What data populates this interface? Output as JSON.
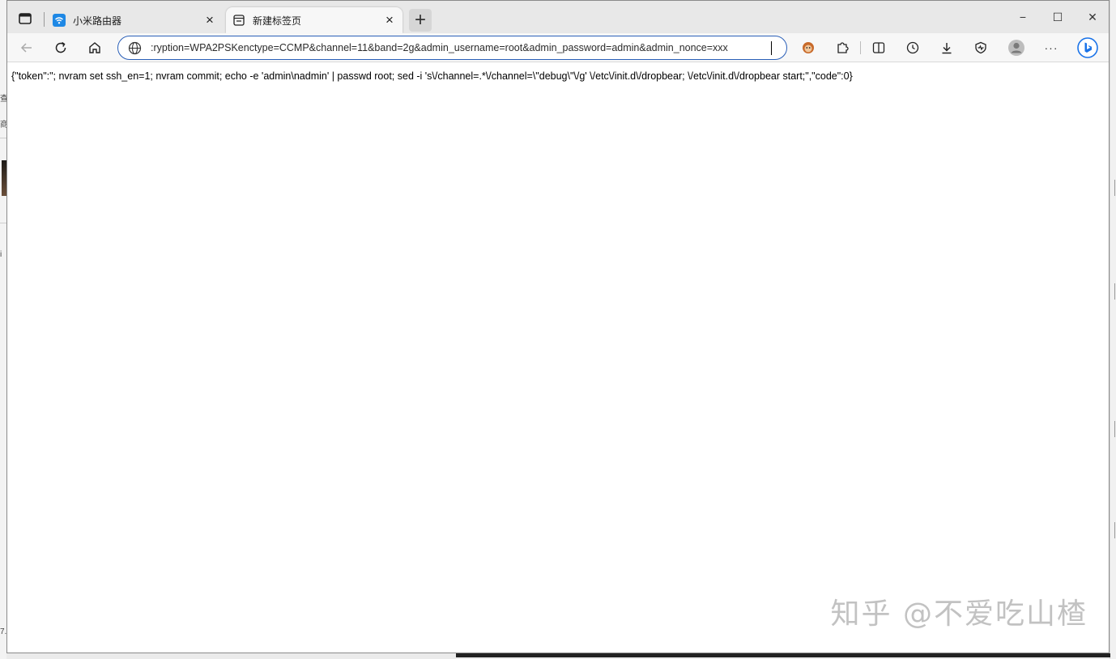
{
  "window": {
    "tabs": [
      {
        "label": "小米路由器",
        "active": false,
        "icon": "wifi-icon"
      },
      {
        "label": "新建标签页",
        "active": true,
        "icon": "newtab-page-icon"
      }
    ],
    "new_tab_label": "+",
    "controls": {
      "minimize": "−",
      "maximize": "☐",
      "close": "✕"
    }
  },
  "toolbar": {
    "url": ":ryption=WPA2PSKenctype=CCMP&channel=11&band=2g&admin_username=root&admin_password=admin&admin_nonce=xxx",
    "more_label": "···"
  },
  "page": {
    "response_text": "{\"token\":\"; nvram set ssh_en=1; nvram commit; echo -e 'admin\\nadmin' | passwd root; sed -i 's\\/channel=.*\\/channel=\\\"debug\\\"\\/g' \\/etc\\/init.d\\/dropbear; \\/etc\\/init.d\\/dropbear start;\",\"code\":0}"
  },
  "watermark": "知乎 @不爱吃山楂",
  "colors": {
    "accent": "#2a5fb8",
    "bing": "#1a73e8",
    "wifi_favicon": "#1e88e5"
  }
}
